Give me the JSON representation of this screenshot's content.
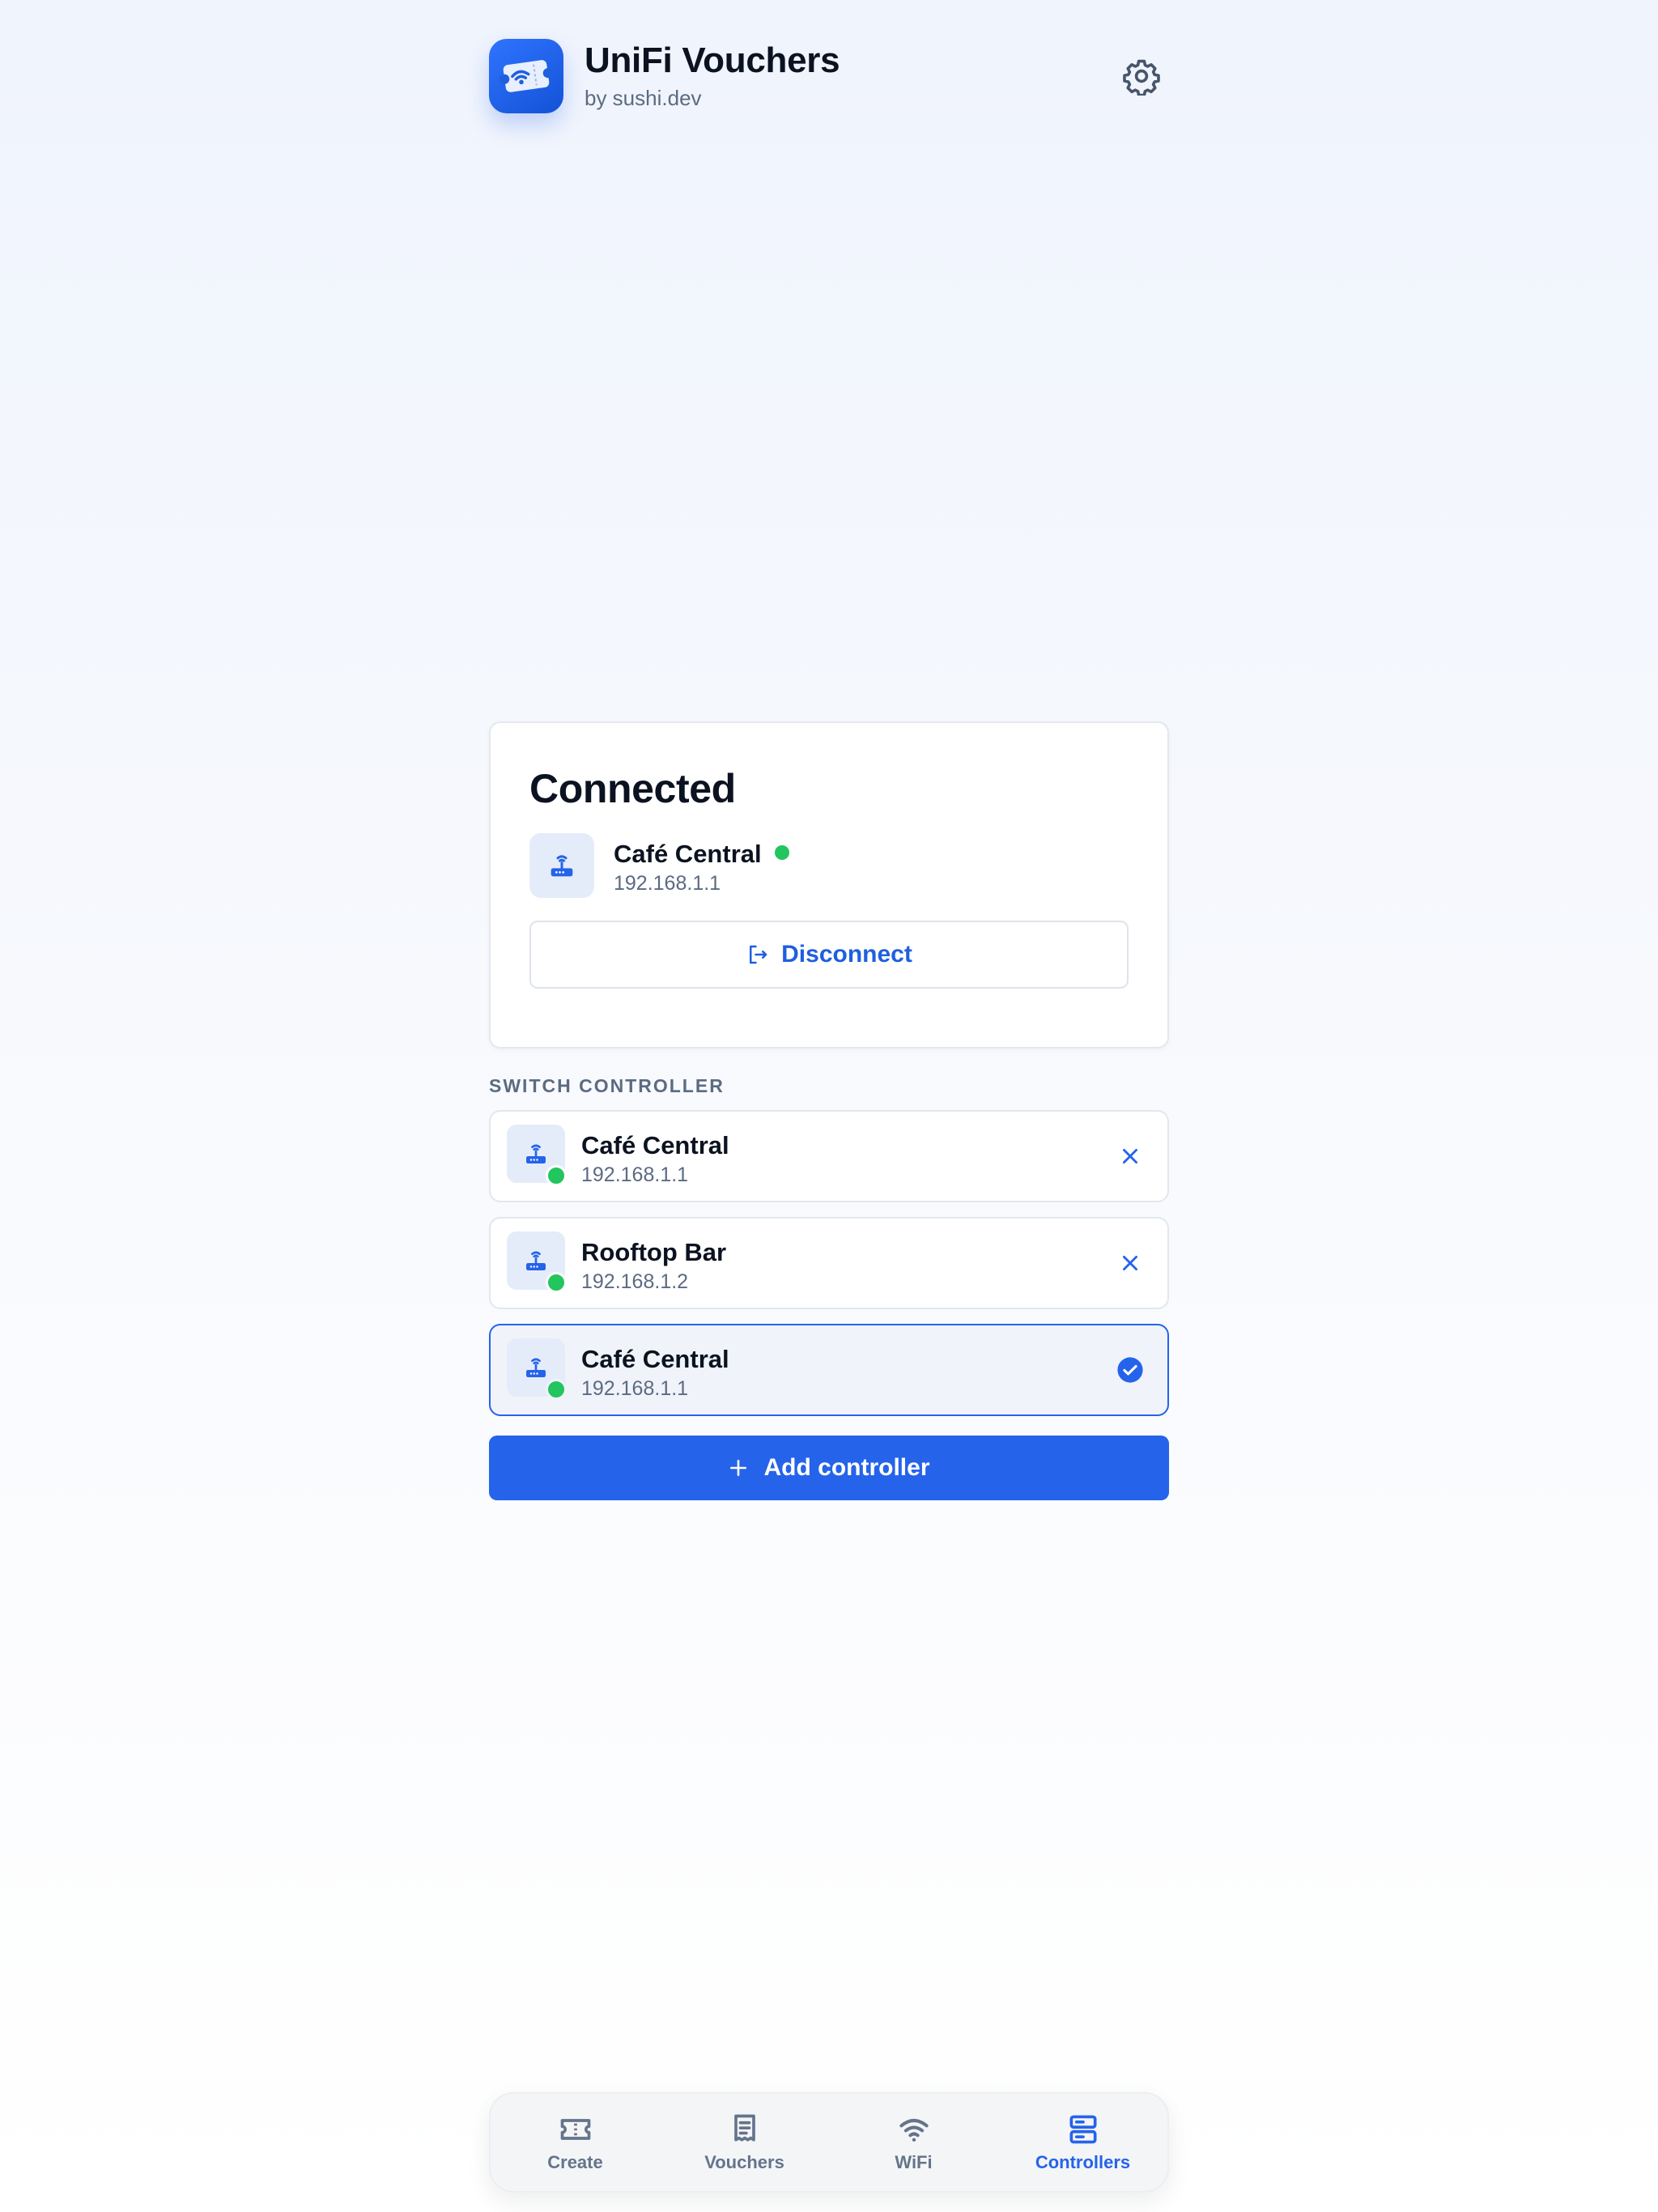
{
  "app": {
    "title": "UniFi Vouchers",
    "subtitle": "by sushi.dev"
  },
  "connected": {
    "title": "Connected",
    "device_name": "Café Central",
    "device_ip": "192.168.1.1",
    "status": "online",
    "disconnect_label": "Disconnect"
  },
  "switch": {
    "label": "SWITCH CONTROLLER",
    "controllers": [
      {
        "name": "Café Central",
        "ip": "192.168.1.1",
        "status": "online",
        "selected": false
      },
      {
        "name": "Rooftop Bar",
        "ip": "192.168.1.2",
        "status": "online",
        "selected": false
      },
      {
        "name": "Café Central",
        "ip": "192.168.1.1",
        "status": "online",
        "selected": true
      }
    ],
    "add_label": "Add controller"
  },
  "tabs": [
    {
      "label": "Create",
      "icon": "ticket-icon",
      "active": false
    },
    {
      "label": "Vouchers",
      "icon": "receipt-icon",
      "active": false
    },
    {
      "label": "WiFi",
      "icon": "wifi-icon",
      "active": false
    },
    {
      "label": "Controllers",
      "icon": "server-icon",
      "active": true
    }
  ],
  "colors": {
    "accent": "#2563eb",
    "online": "#22c55e",
    "muted": "#5b6b82"
  }
}
